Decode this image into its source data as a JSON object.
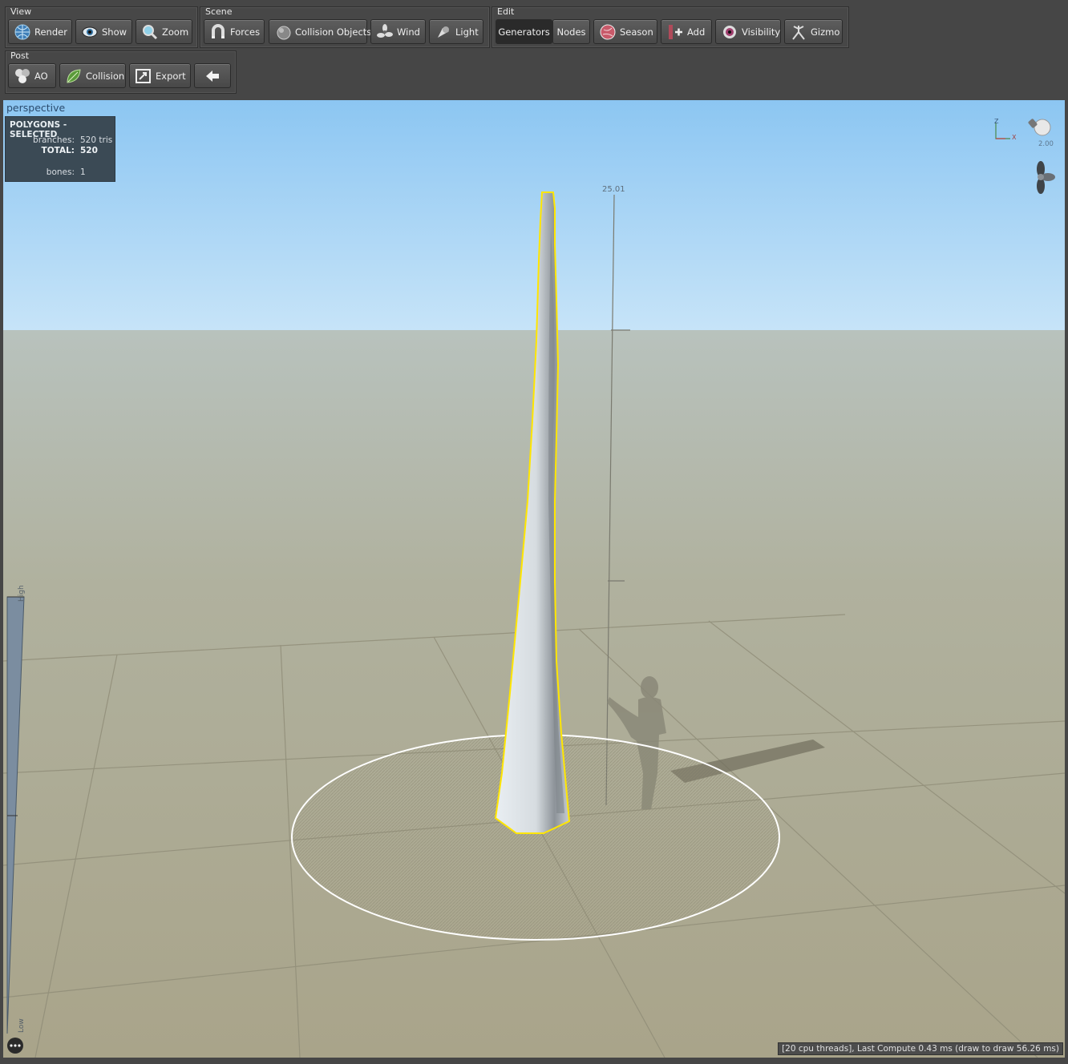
{
  "groups": {
    "view": "View",
    "scene": "Scene",
    "edit": "Edit",
    "post": "Post"
  },
  "toolbar": {
    "view": [
      "Render",
      "Show",
      "Zoom"
    ],
    "scene": [
      "Forces",
      "Collision Objects",
      "Wind",
      "Light"
    ],
    "edit": [
      "Generators",
      "Nodes",
      "Season",
      "Add",
      "Visibility",
      "Gizmo"
    ],
    "post": [
      "AO",
      "Collision",
      "Export"
    ]
  },
  "viewport": {
    "mode": "perspective",
    "stats": {
      "title": "POLYGONS - SELECTED",
      "branches_label": "branches:",
      "branches_value": "520",
      "branches_unit": "tris",
      "total_label": "TOTAL:",
      "total_value": "520",
      "bones_label": "bones:",
      "bones_value": "1"
    },
    "ruler_value": "25.01",
    "light_value": "2.00",
    "axis_z": "Z",
    "axis_x": "X",
    "lod_high": "High",
    "lod_low": "Low",
    "status": "[20 cpu threads], Last Compute 0.43 ms (draw to draw 56.26 ms)"
  },
  "colors": {
    "sky_top": "#8cc6f2",
    "sky_bottom": "#c7e4f8",
    "ground": "#a9a690",
    "selection": "#ffe600"
  }
}
